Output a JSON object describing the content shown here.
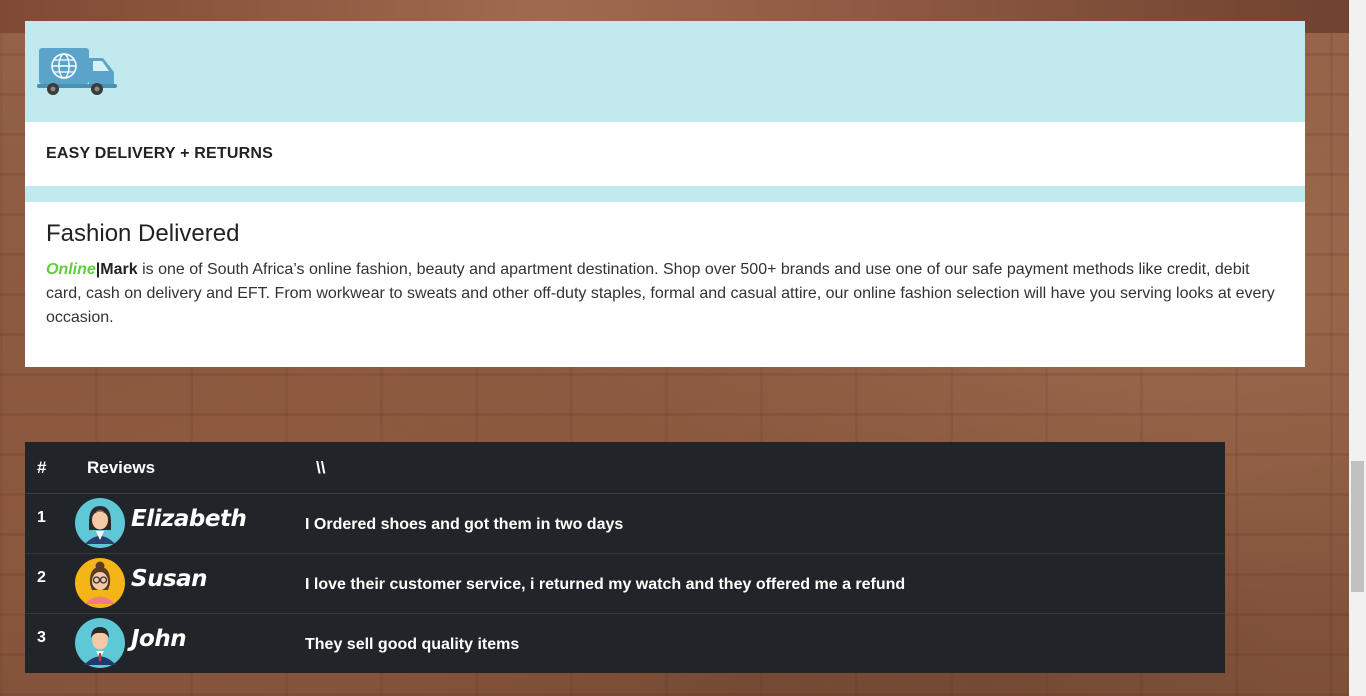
{
  "feature": {
    "title": "EASY DELIVERY + RETURNS",
    "icon": "delivery-truck-icon"
  },
  "about": {
    "heading": "Fashion Delivered",
    "brand_online": "Online",
    "brand_sep": "|",
    "brand_mark": "Mark",
    "description": " is one of South Africa’s online fashion, beauty and apartment destination. Shop over 500+ brands and use one of our safe payment methods like credit, debit card, cash on delivery and EFT. From workwear to sweats and other off-duty staples, formal and casual attire, our online fashion selection will have you serving looks at every occasion."
  },
  "reviews": {
    "headers": {
      "num": "#",
      "reviews": "Reviews",
      "extra": "\\\\"
    },
    "rows": [
      {
        "num": "1",
        "name": "Elizabeth",
        "text": "I Ordered shoes and got them in two days",
        "avatar": "woman-avatar-icon"
      },
      {
        "num": "2",
        "name": "Susan",
        "text": "I love their customer service, i returned my watch and they offered me a refund",
        "avatar": "woman-glasses-avatar-icon"
      },
      {
        "num": "3",
        "name": "John",
        "text": "They sell good quality items",
        "avatar": "man-avatar-icon"
      }
    ]
  },
  "colors": {
    "accent_band": "#c1e9ee",
    "brand_green": "#5fcf3a",
    "table_bg": "#212529"
  }
}
